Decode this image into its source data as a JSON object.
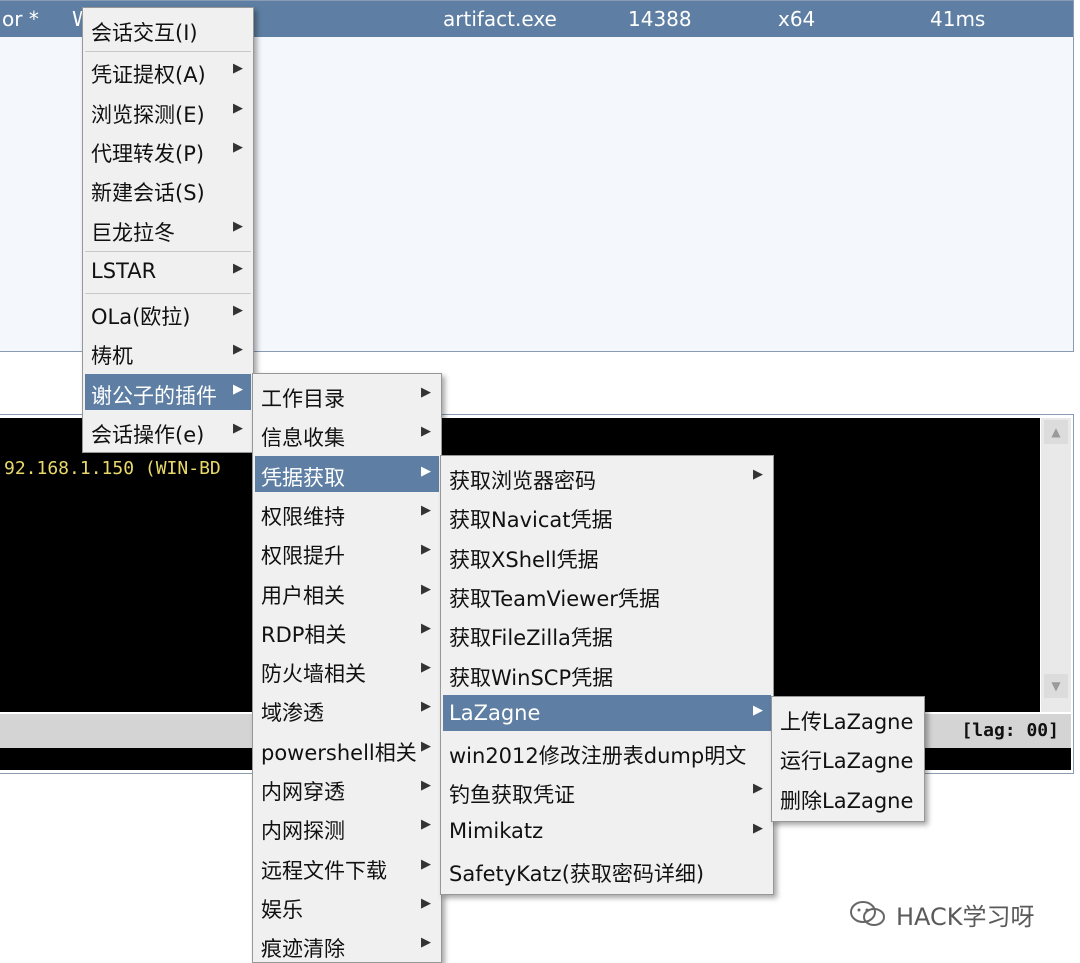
{
  "session_row": {
    "user": "or *",
    "computer": "Wi",
    "process": "artifact.exe",
    "pid": "14388",
    "arch": "x64",
    "last": "41ms"
  },
  "console": {
    "line": "92.168.1.150  (WIN-BD",
    "lag": "[lag: 00]"
  },
  "menu_main": {
    "items": [
      {
        "label": "会话交互(I)",
        "submenu": false
      },
      {
        "label": "凭证提权(A)",
        "submenu": true
      },
      {
        "label": "浏览探测(E)",
        "submenu": true
      },
      {
        "label": "代理转发(P)",
        "submenu": true
      },
      {
        "label": "新建会话(S)",
        "submenu": false
      },
      {
        "label": "巨龙拉冬",
        "submenu": true
      },
      {
        "label": "LSTAR",
        "submenu": true
      },
      {
        "label": "OLa(欧拉)",
        "submenu": true
      },
      {
        "label": "梼杌",
        "submenu": true
      },
      {
        "label": "谢公子的插件",
        "submenu": true,
        "selected": true
      },
      {
        "label": "会话操作(e)",
        "submenu": true
      }
    ]
  },
  "menu_plugin": {
    "items": [
      {
        "label": "工作目录",
        "submenu": true
      },
      {
        "label": "信息收集",
        "submenu": true
      },
      {
        "label": "凭据获取",
        "submenu": true,
        "selected": true
      },
      {
        "label": "权限维持",
        "submenu": true
      },
      {
        "label": "权限提升",
        "submenu": true
      },
      {
        "label": "用户相关",
        "submenu": true
      },
      {
        "label": "RDP相关",
        "submenu": true
      },
      {
        "label": "防火墙相关",
        "submenu": true
      },
      {
        "label": "域渗透",
        "submenu": true
      },
      {
        "label": "powershell相关",
        "submenu": true
      },
      {
        "label": "内网穿透",
        "submenu": true
      },
      {
        "label": "内网探测",
        "submenu": true
      },
      {
        "label": "远程文件下载",
        "submenu": true
      },
      {
        "label": "娱乐",
        "submenu": true
      },
      {
        "label": "痕迹清除",
        "submenu": true
      }
    ]
  },
  "menu_credential": {
    "items": [
      {
        "label": "获取浏览器密码",
        "submenu": true
      },
      {
        "label": "获取Navicat凭据",
        "submenu": false
      },
      {
        "label": "获取XShell凭据",
        "submenu": false
      },
      {
        "label": "获取TeamViewer凭据",
        "submenu": false
      },
      {
        "label": "获取FileZilla凭据",
        "submenu": false
      },
      {
        "label": "获取WinSCP凭据",
        "submenu": false
      },
      {
        "label": "LaZagne",
        "submenu": true,
        "selected": true
      },
      {
        "label": "win2012修改注册表dump明文",
        "submenu": false
      },
      {
        "label": "钓鱼获取凭证",
        "submenu": true
      },
      {
        "label": "Mimikatz",
        "submenu": true
      },
      {
        "label": "SafetyKatz(获取密码详细)",
        "submenu": false
      }
    ]
  },
  "menu_lazagne": {
    "items": [
      {
        "label": "上传LaZagne",
        "submenu": false
      },
      {
        "label": "运行LaZagne",
        "submenu": false
      },
      {
        "label": "删除LaZagne",
        "submenu": false
      }
    ]
  },
  "watermark": {
    "text": "HACK学习呀",
    "icon": "wechat-icon"
  },
  "colors": {
    "selection": "#5e7fa3",
    "menu_bg": "#f0f0f0",
    "console_bg": "#000000",
    "console_text": "#e8d96a"
  }
}
